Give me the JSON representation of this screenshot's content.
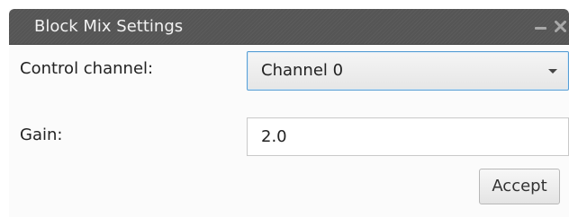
{
  "window": {
    "title": "Block Mix Settings",
    "minimize_icon": "minimize-icon",
    "close_icon": "close-icon"
  },
  "form": {
    "control_channel": {
      "label": "Control channel:",
      "value": "Channel 0",
      "icon": "chevron-down-icon"
    },
    "gain": {
      "label": "Gain:",
      "value": "2.0"
    },
    "accept_label": "Accept"
  },
  "colors": {
    "titlebar": "#555555",
    "focus_border": "#5a9fd4"
  }
}
